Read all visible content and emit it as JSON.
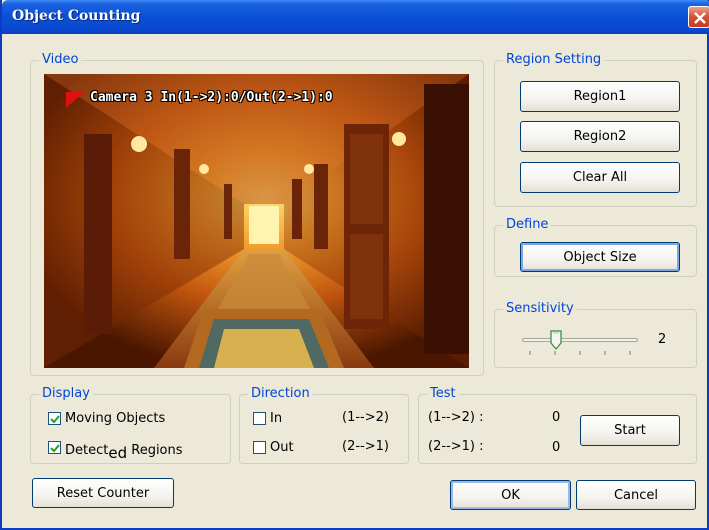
{
  "window": {
    "title": "Object Counting"
  },
  "video": {
    "group_label": "Video",
    "overlay": "Camera 3 In(1->2):0/Out(2->1):0"
  },
  "region_setting": {
    "group_label": "Region Setting",
    "region1": "Region1",
    "region2": "Region2",
    "clear_all": "Clear All"
  },
  "define": {
    "group_label": "Define",
    "object_size": "Object Size"
  },
  "sensitivity": {
    "group_label": "Sensitivity",
    "value": "2",
    "level_fraction": 0.2
  },
  "display": {
    "group_label": "Display",
    "moving_objects": {
      "label": "Moving Objects",
      "checked": true
    },
    "detected_regions": {
      "label_pre": "Detect",
      "label_sub": "ed",
      "label_post": " Regions",
      "checked": true
    }
  },
  "direction": {
    "group_label": "Direction",
    "in": {
      "label": "In",
      "desc": "(1-->2)",
      "checked": false
    },
    "out": {
      "label": "Out",
      "desc": "(2-->1)",
      "checked": false
    }
  },
  "test": {
    "group_label": "Test",
    "row1_label": "(1-->2) :",
    "row1_value": "0",
    "row2_label": "(2-->1) :",
    "row2_value": "0",
    "start": "Start"
  },
  "buttons": {
    "reset_counter": "Reset Counter",
    "ok": "OK",
    "cancel": "Cancel"
  },
  "colors": {
    "titlebar": "#0a4fd6",
    "dialog_bg": "#ece9d8",
    "group_label": "#0046d5"
  }
}
